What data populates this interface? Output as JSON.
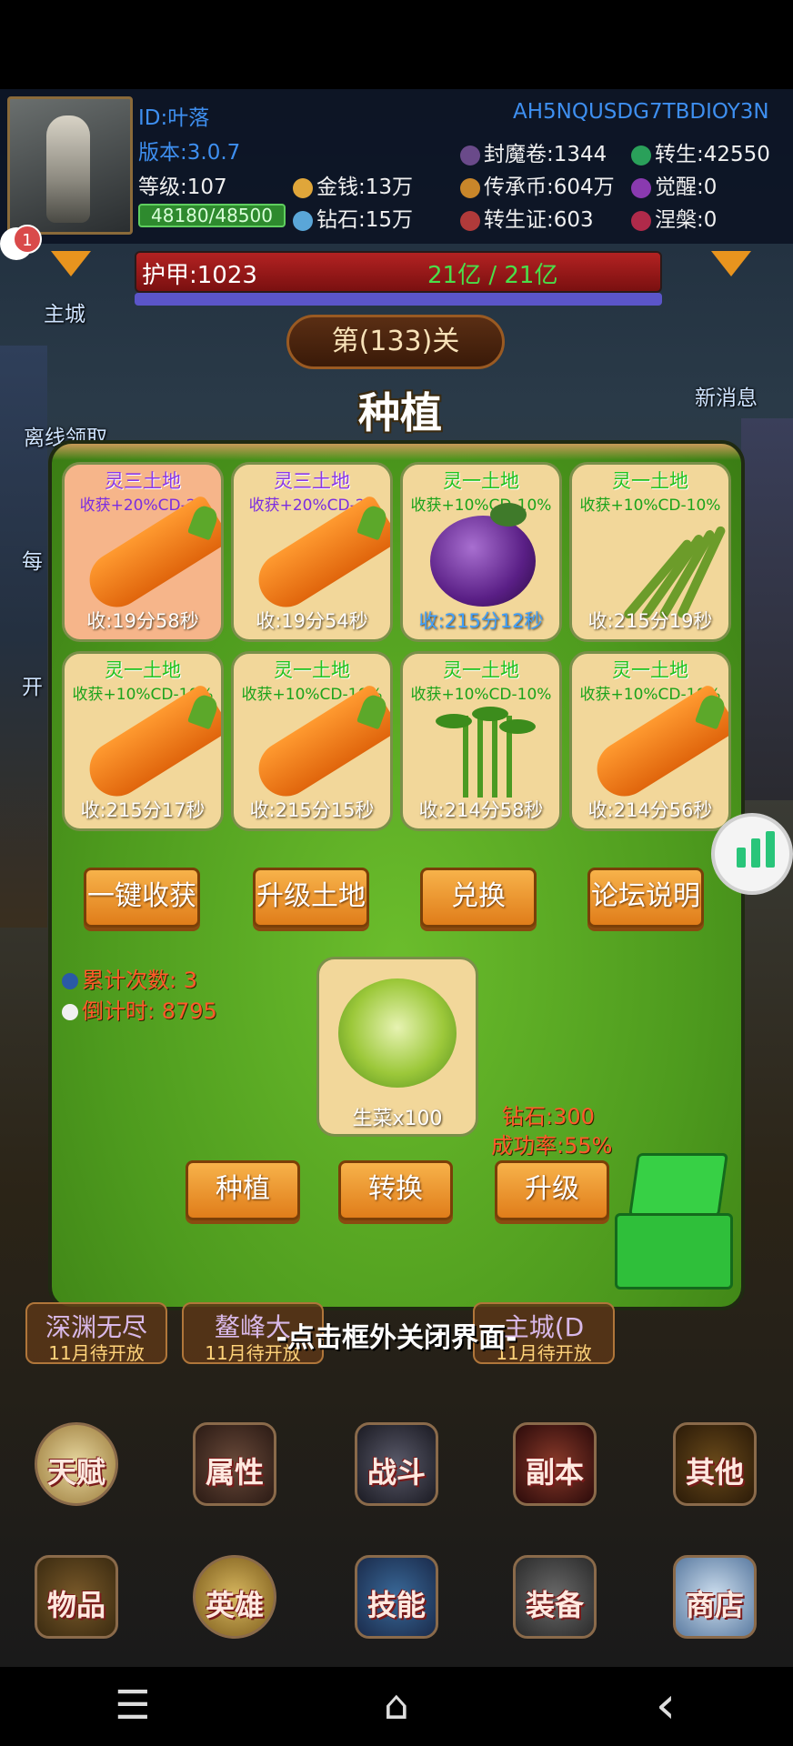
{
  "header": {
    "player_id": "ID:叶落",
    "version": "版本:3.0.7",
    "level": "等级:107",
    "exp": "48180/48500",
    "gold": "金钱:13万",
    "diamond": "钻石:15万",
    "code": "AH5NQUSDG7TBDIOY3N",
    "seal_scroll": "封魔卷:1344",
    "inherit_coin": "传承币:604万",
    "rebirth_cert": "转生证:603",
    "rebirth": "转生:42550",
    "awaken": "觉醒:0",
    "nirvana": "涅槃:0"
  },
  "notification_badge": "1",
  "armor": {
    "label": "护甲:1023",
    "hp": "21亿 / 21亿"
  },
  "stage": "第(133)关",
  "side_labels": {
    "main_city": "主城",
    "offline_reward": "离线领取",
    "new_message": "新消息",
    "daily": "每",
    "open": "开"
  },
  "dialog": {
    "title": "种植",
    "plots": [
      {
        "name": "灵三土地",
        "bonus": "收获+20%CD-20",
        "timer": "收:19分58秒",
        "crop": "carrot",
        "tier": "purple"
      },
      {
        "name": "灵三土地",
        "bonus": "收获+20%CD-20",
        "timer": "收:19分54秒",
        "crop": "carrot",
        "tier": "purple"
      },
      {
        "name": "灵一土地",
        "bonus": "收获+10%CD-10%",
        "timer": "收:215分12秒",
        "crop": "eggplant",
        "tier": "green"
      },
      {
        "name": "灵一土地",
        "bonus": "收获+10%CD-10%",
        "timer": "收:215分19秒",
        "crop": "beans",
        "tier": "green"
      },
      {
        "name": "灵一土地",
        "bonus": "收获+10%CD-10%",
        "timer": "收:215分17秒",
        "crop": "carrot",
        "tier": "green"
      },
      {
        "name": "灵一土地",
        "bonus": "收获+10%CD-10%",
        "timer": "收:215分15秒",
        "crop": "carrot",
        "tier": "green"
      },
      {
        "name": "灵一土地",
        "bonus": "收获+10%CD-10%",
        "timer": "收:214分58秒",
        "crop": "greens",
        "tier": "green"
      },
      {
        "name": "灵一土地",
        "bonus": "收获+10%CD-10%",
        "timer": "收:214分56秒",
        "crop": "carrot",
        "tier": "green"
      }
    ],
    "buttons": {
      "harvest_all": "一键收获",
      "upgrade_land": "升级土地",
      "exchange": "兑换",
      "forum": "论坛说明"
    },
    "stats": {
      "count": "累计次数: 3",
      "countdown": "倒计时: 8795"
    },
    "seed": {
      "label": "生菜x100"
    },
    "upgrade_info": {
      "diamond": "钻石:300",
      "success": "成功率:55%"
    },
    "actions": {
      "plant": "种植",
      "convert": "转换",
      "upgrade": "升级"
    }
  },
  "close_hint": "-点击框外关闭界面-",
  "events": [
    {
      "title": "深渊无尽",
      "sub": "11月待开放"
    },
    {
      "title": "鳌峰大",
      "sub": "11月待开放"
    },
    {
      "title": "主城(D",
      "sub": "11月待开放"
    }
  ],
  "menu_row1": [
    "天赋",
    "属性",
    "战斗",
    "副本",
    "其他"
  ],
  "menu_row2": [
    "物品",
    "英雄",
    "技能",
    "装备",
    "商店"
  ],
  "nav": {
    "menu": "☰",
    "home": "⌂",
    "back": "‹"
  },
  "colors": {
    "accent": "#e07d1a",
    "grass": "#4e9b1e",
    "armor": "#b32222"
  }
}
